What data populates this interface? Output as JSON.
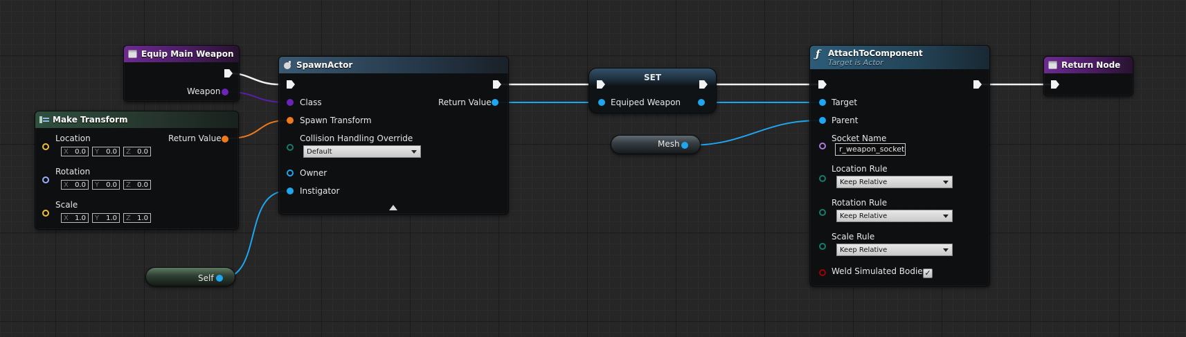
{
  "colors": {
    "exec": "#f2f2f2",
    "object_pin": "#6a24b8",
    "struct_pin": "#f07a1a",
    "vector_pin": "#f2c030",
    "rotator_pin": "#9ab0ff",
    "actor_pin": "#1ea6f0",
    "byte_pin": "#1a7a6c",
    "name_pin": "#b07ad6",
    "bool_pin": "#a00000"
  },
  "equip_node": {
    "title": "Equip Main Weapon",
    "icon": "event-box-icon",
    "weapon_label": "Weapon"
  },
  "make_transform": {
    "title": "Make Transform",
    "icon": "struct-icon",
    "return_label": "Return Value",
    "rows": [
      {
        "label": "Location",
        "x": "0.0",
        "y": "0.0",
        "z": "0.0"
      },
      {
        "label": "Rotation",
        "x": "0.0",
        "y": "0.0",
        "z": "0.0"
      },
      {
        "label": "Scale",
        "x": "1.0",
        "y": "1.0",
        "z": "1.0"
      }
    ],
    "axes": [
      "X",
      "Y",
      "Z"
    ]
  },
  "spawn_actor": {
    "title": "SpawnActor",
    "icon": "spawn-icon",
    "class_label": "Class",
    "spawn_transform_label": "Spawn Transform",
    "collision_label": "Collision Handling Override",
    "collision_value": "Default",
    "owner_label": "Owner",
    "instigator_label": "Instigator",
    "return_label": "Return Value"
  },
  "set_node": {
    "title": "SET",
    "var_label": "Equiped Weapon"
  },
  "mesh_node": {
    "label": "Mesh"
  },
  "self_node": {
    "label": "Self"
  },
  "attach_node": {
    "title": "AttachToComponent",
    "subtitle": "Target is Actor",
    "icon": "function-icon",
    "target_label": "Target",
    "parent_label": "Parent",
    "socket_label": "Socket Name",
    "socket_value": "r_weapon_socket",
    "location_rule_label": "Location Rule",
    "location_rule_value": "Keep Relative",
    "rotation_rule_label": "Rotation Rule",
    "rotation_rule_value": "Keep Relative",
    "scale_rule_label": "Scale Rule",
    "scale_rule_value": "Keep Relative",
    "weld_label": "Weld Simulated Bodies",
    "weld_checked": true
  },
  "return_node": {
    "title": "Return Node",
    "icon": "return-box-icon"
  }
}
